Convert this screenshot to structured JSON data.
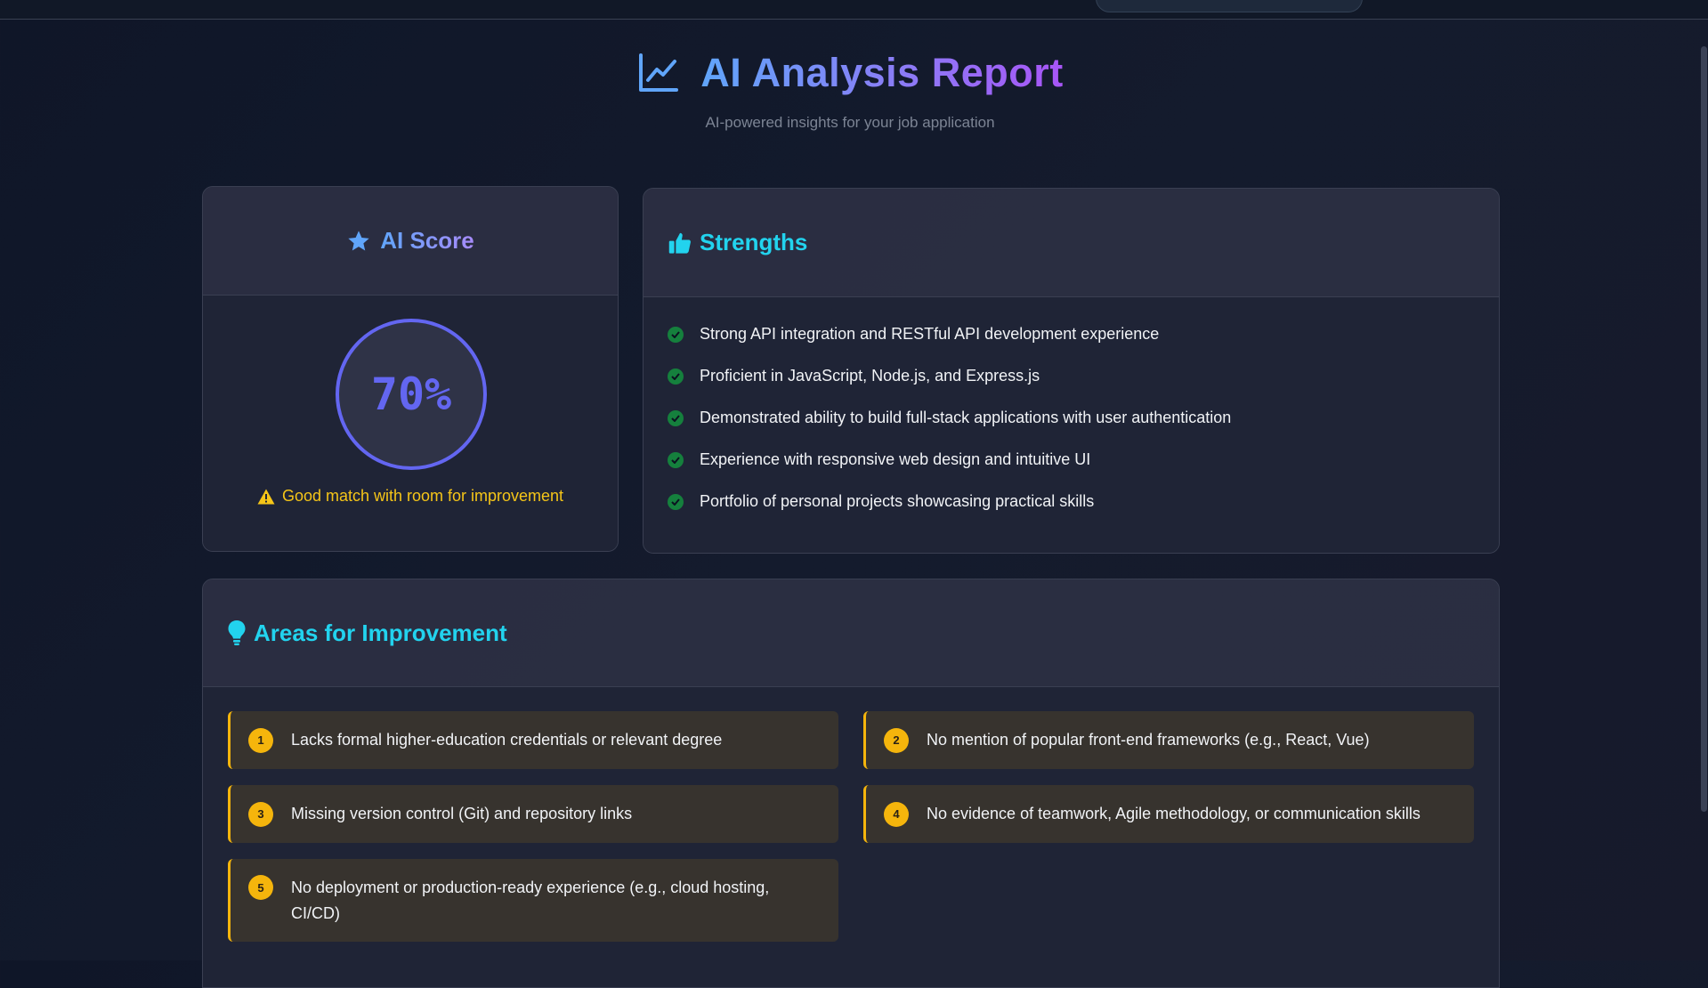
{
  "header": {
    "title": "AI Analysis Report",
    "subtitle": "AI-powered insights for your job application",
    "icon": "chart-line-icon",
    "gradient": [
      "#60a5fa",
      "#a855f7"
    ]
  },
  "score": {
    "heading": "AI Score",
    "icon": "star-icon",
    "value": "70%",
    "note": "Good match with room for improvement",
    "note_icon": "warning-icon",
    "ring_color": "#6366f1"
  },
  "strengths": {
    "heading": "Strengths",
    "icon": "thumbs-up-icon",
    "items": [
      "Strong API integration and RESTful API development experience",
      "Proficient in JavaScript, Node.js, and Express.js",
      "Demonstrated ability to build full-stack applications with user authentication",
      "Experience with responsive web design and intuitive UI",
      "Portfolio of personal projects showcasing practical skills"
    ]
  },
  "improvements": {
    "heading": "Areas for Improvement",
    "icon": "lightbulb-icon",
    "accent": "#f5b50c",
    "items": [
      {
        "num": "1",
        "text": "Lacks formal higher-education credentials or relevant degree"
      },
      {
        "num": "2",
        "text": "No mention of popular front-end frameworks (e.g., React, Vue)"
      },
      {
        "num": "3",
        "text": "Missing version control (Git) and repository links"
      },
      {
        "num": "4",
        "text": "No evidence of teamwork, Agile methodology, or communication skills"
      },
      {
        "num": "5",
        "text": "No deployment or production-ready experience (e.g., cloud hosting, CI/CD)"
      }
    ]
  }
}
